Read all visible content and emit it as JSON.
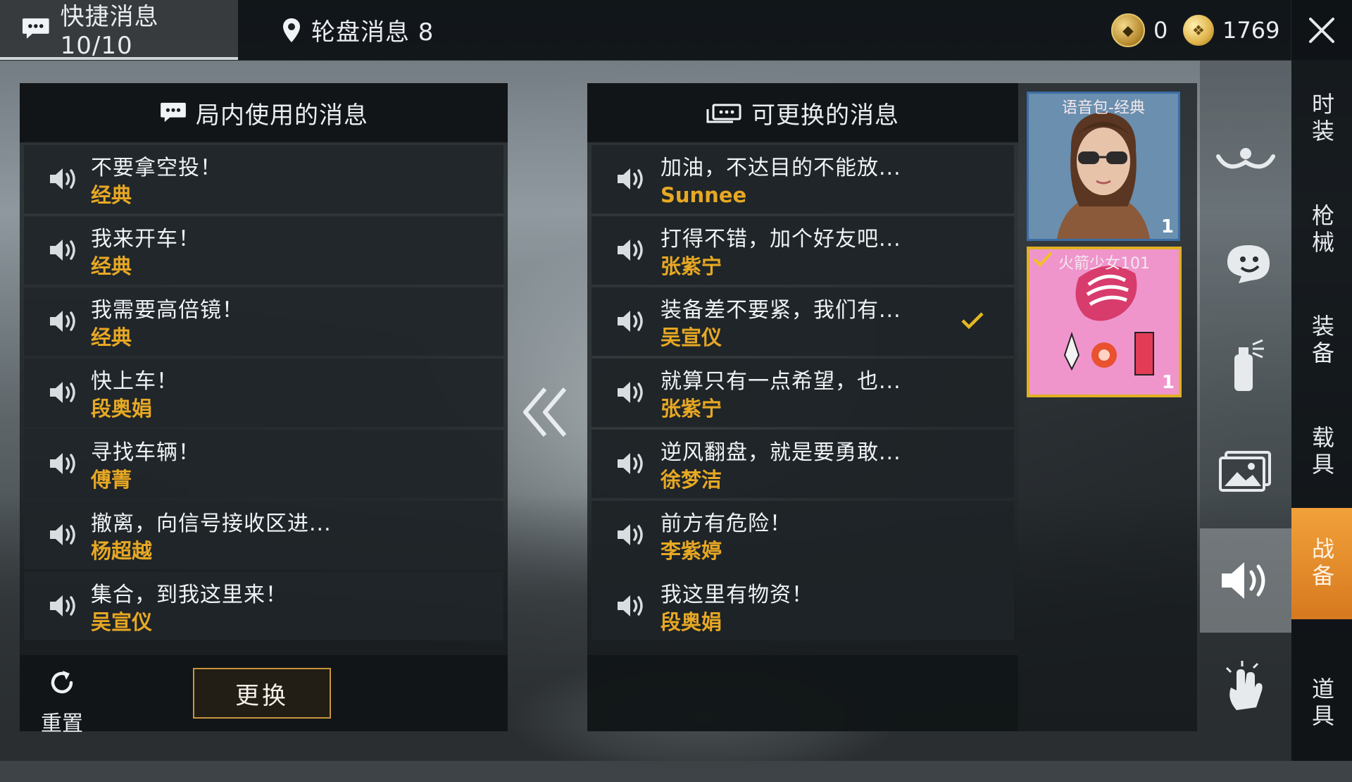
{
  "topbar": {
    "quick_tab": "快捷消息 10/10",
    "wheel_tab": "轮盘消息 8",
    "currency_a": "0",
    "currency_b": "1769"
  },
  "left_panel": {
    "title": "局内使用的消息",
    "rows": [
      {
        "text": "不要拿空投！",
        "voice": "经典"
      },
      {
        "text": "我来开车！",
        "voice": "经典"
      },
      {
        "text": "我需要高倍镜！",
        "voice": "经典"
      },
      {
        "text": "快上车！",
        "voice": "段奥娟"
      },
      {
        "text": "寻找车辆！",
        "voice": "傅菁"
      },
      {
        "text": "撤离，向信号接收区进...",
        "voice": "杨超越"
      },
      {
        "text": "集合，到我这里来！",
        "voice": "吴宣仪"
      }
    ],
    "reset_label": "重置",
    "swap_label": "更换"
  },
  "right_panel": {
    "title": "可更换的消息",
    "rows": [
      {
        "text": "加油，不达目的不能放...",
        "voice": "Sunnee"
      },
      {
        "text": "打得不错，加个好友吧...",
        "voice": "张紫宁"
      },
      {
        "text": "装备差不要紧，我们有...",
        "voice": "吴宣仪"
      },
      {
        "text": "就算只有一点希望，也...",
        "voice": "张紫宁"
      },
      {
        "text": "逆风翻盘，就是要勇敢...",
        "voice": "徐梦洁"
      },
      {
        "text": "前方有危险！",
        "voice": "李紫婷"
      },
      {
        "text": "我这里有物资！",
        "voice": "段奥娟"
      }
    ],
    "selected_index": 2
  },
  "cards": [
    {
      "title": "语音包-经典",
      "count": "1"
    },
    {
      "title": "火箭少女101",
      "count": "1"
    }
  ],
  "categories": [
    {
      "label": "时装"
    },
    {
      "label": "枪械"
    },
    {
      "label": "装备"
    },
    {
      "label": "载具"
    },
    {
      "label": "战备"
    },
    {
      "label": "道具"
    }
  ],
  "colors": {
    "accent_orange": "#e7a824",
    "active_category": "#e58a2a",
    "card_selected_border": "#e0b123"
  }
}
